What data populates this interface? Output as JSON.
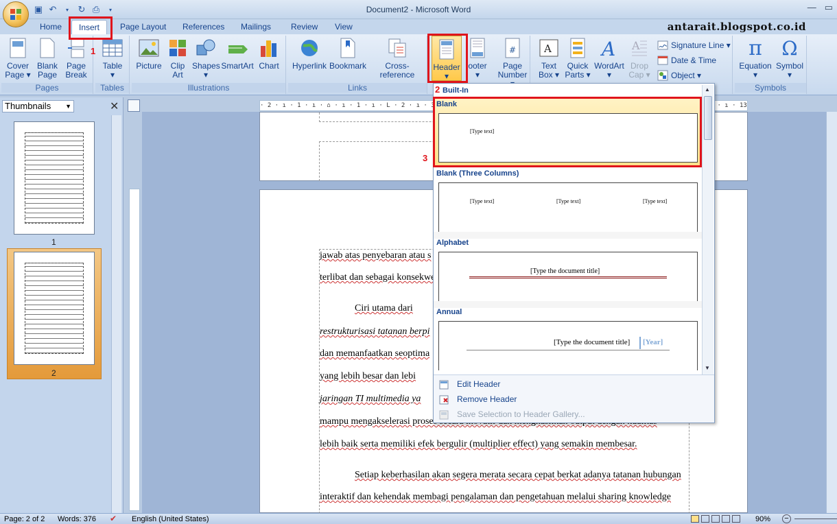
{
  "window": {
    "title": "Document2 - Microsoft Word",
    "blog": "antarait.blogspot.co.id"
  },
  "tabs": [
    "Home",
    "Insert",
    "Page Layout",
    "References",
    "Mailings",
    "Review",
    "View"
  ],
  "ribbon": {
    "pages": {
      "label": "Pages",
      "cover": [
        "Cover",
        "Page ▾"
      ],
      "blank": [
        "Blank",
        "Page"
      ],
      "break": [
        "Page",
        "Break"
      ]
    },
    "tables": {
      "label": "Tables",
      "table": [
        "Table",
        "▾"
      ]
    },
    "illustrations": {
      "label": "Illustrations",
      "picture": "Picture",
      "clipart": [
        "Clip",
        "Art"
      ],
      "shapes": [
        "Shapes",
        "▾"
      ],
      "smartart": "SmartArt",
      "chart": "Chart"
    },
    "links": {
      "label": "Links",
      "hyperlink": "Hyperlink",
      "bookmark": "Bookmark",
      "crossref": "Cross-reference"
    },
    "headerfooter": {
      "header": [
        "Header",
        "▾"
      ],
      "footer": [
        "ooter",
        "▾"
      ],
      "pagenumber": [
        "Page",
        "Number ▾"
      ]
    },
    "text": {
      "textbox": [
        "Text",
        "Box ▾"
      ],
      "quickparts": [
        "Quick",
        "Parts ▾"
      ],
      "wordart": [
        "WordArt",
        "▾"
      ],
      "dropcap": [
        "Drop",
        "Cap ▾"
      ],
      "sigline": "Signature Line ▾",
      "datetime": "Date & Time",
      "object": "Object ▾"
    },
    "symbols": {
      "label": "Symbols",
      "equation": [
        "Equation",
        "▾"
      ],
      "symbol": [
        "Symbol",
        "▾"
      ]
    }
  },
  "annotations": {
    "n1": "1",
    "n2": "2",
    "n3": "3"
  },
  "thumbnails": {
    "label": "Thumbnails",
    "close": "✕",
    "page1": "1",
    "page2": "2"
  },
  "ruler": "· 2 · ı · 1 · ı · ⌂ · ı · 1 · ı · L · 2 · ı · 3 · ı · 4 · ı · 5 · ı · 6 · ı · 7 · ı · 8 · ı · 9 · ı · 10 · ı · 11 · ı · 12 · ı · 13 · ı · 14 · ı · 15 · ı · 16 · ı · 17 · ı · 18 ·",
  "document": {
    "lines": [
      "jawab atas penyebaran atau s",
      "terlibat dan sebagai konsekwe",
      "Ciri  utama  dari  ",
      "restrukturisasi tatanan berpi",
      "dan memanfaatkan seoptima",
      "yang  lebih  besar  dan  lebi",
      "jaringan  TI  multimedia  ya",
      "mampu  mengakselerasi  proses  secara  inovatif  dan  menghasilkan  output  dengan  kualitas",
      "lebih baik serta memiliki efek bergulir (multiplier effect) yang semakin membesar.",
      "Setiap  keberhasilan akan segera merata secara cepat berkat adanya tatanan hubungan",
      "interaktif  dan  kehendak  membagi  pengalaman  dan  pengetahuan  melalui  sharing knowledge"
    ]
  },
  "gallery": {
    "section": "Built-In",
    "items": [
      {
        "name": "Blank",
        "texts": [
          "[Type text]"
        ]
      },
      {
        "name": "Blank (Three Columns)",
        "texts": [
          "[Type text]",
          "[Type text]",
          "[Type text]"
        ]
      },
      {
        "name": "Alphabet",
        "texts": [
          "[Type the document title]"
        ]
      },
      {
        "name": "Annual",
        "texts": [
          "[Type the document title]",
          "[Year]"
        ]
      }
    ],
    "menu": [
      "Edit Header",
      "Remove Header",
      "Save Selection to Header Gallery..."
    ]
  },
  "status": {
    "page": "Page: 2 of 2",
    "words": "Words: 376",
    "language": "English (United States)",
    "zoom": "90%"
  }
}
